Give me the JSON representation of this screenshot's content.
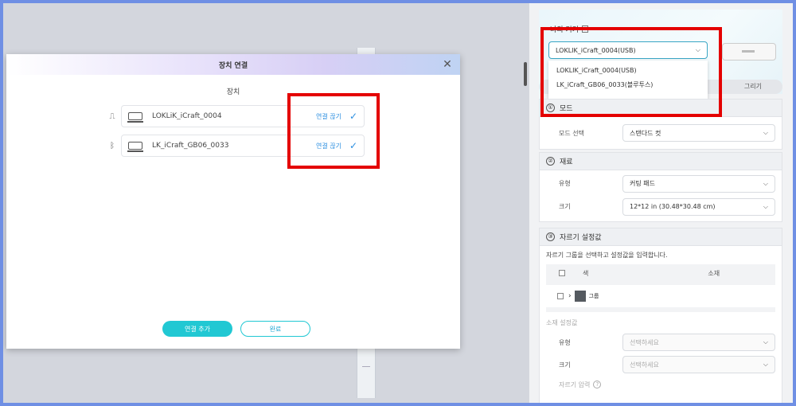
{
  "dialog": {
    "title": "장치 연결",
    "subtitle": "장치",
    "devices": [
      {
        "name": "LOKLiK_iCraft_0004",
        "action": "연결 끊기",
        "connection": "usb"
      },
      {
        "name": "LK_iCraft_GB06_0033",
        "action": "연결 끊기",
        "connection": "bluetooth"
      }
    ],
    "add_button": "연결 추가",
    "done_button": "완료"
  },
  "panel": {
    "my_device_title": "나의 기기",
    "device_select_value": "LOKLIK_iCraft_0004(USB)",
    "device_options": [
      "LOKLIK_iCraft_0004(USB)",
      "LK_iCraft_GB06_0033(블루투스)"
    ],
    "tab_draw": "그리기",
    "mode": {
      "num": "①",
      "title": "모드",
      "select_label": "모드 선택",
      "select_value": "스탠다드 컷"
    },
    "material": {
      "num": "②",
      "title": "재료",
      "type_label": "유형",
      "type_value": "커팅 패드",
      "size_label": "크기",
      "size_value": "12*12 in (30.48*30.48 cm)"
    },
    "cut_settings": {
      "num": "③",
      "title": "자르기 설정값",
      "description": "자르기 그룹을 선택하고 설정값을 입력합니다.",
      "col_color": "색",
      "col_material": "소재",
      "group_label": "그룹",
      "group_color": "#555a60",
      "material_settings_label": "소재 설정값",
      "type_label": "유형",
      "type_placeholder": "선택하세요",
      "size_label": "크기",
      "size_placeholder": "선택하세요",
      "pressure_label": "자르기 압력"
    }
  },
  "colors": {
    "accent": "#21c8d3",
    "link": "#2c8fe0",
    "highlight": "#e40000",
    "frame": "#6f8fe4"
  }
}
